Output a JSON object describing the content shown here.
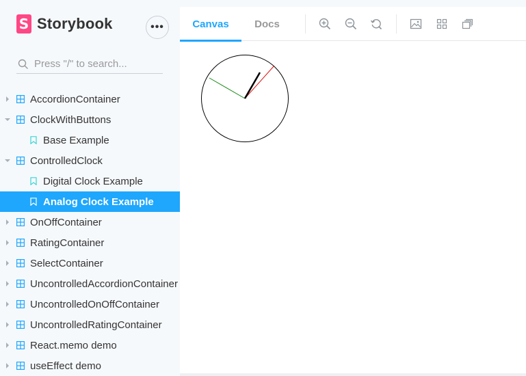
{
  "brand": {
    "logo_letter": "S",
    "name": "Storybook"
  },
  "menu": {
    "label": "•••"
  },
  "search": {
    "placeholder": "Press \"/\" to search..."
  },
  "tree": {
    "items": [
      {
        "label": "AccordionContainer"
      },
      {
        "label": "ClockWithButtons"
      },
      {
        "label": "Base Example"
      },
      {
        "label": "ControlledClock"
      },
      {
        "label": "Digital Clock Example"
      },
      {
        "label": "Analog Clock Example"
      },
      {
        "label": "OnOffContainer"
      },
      {
        "label": "RatingContainer"
      },
      {
        "label": "SelectContainer"
      },
      {
        "label": "UncontrolledAccordionContainer"
      },
      {
        "label": "UncontrolledOnOffContainer"
      },
      {
        "label": "UncontrolledRatingContainer"
      },
      {
        "label": "React.memo demo"
      },
      {
        "label": "useEffect demo"
      }
    ]
  },
  "toolbar": {
    "tabs": [
      {
        "label": "Canvas"
      },
      {
        "label": "Docs"
      }
    ],
    "active_tab": "Canvas",
    "icons": [
      "zoom-in-icon",
      "zoom-out-icon",
      "reset-zoom-icon",
      "background-icon",
      "grid-icon",
      "measure-icon"
    ]
  },
  "colors": {
    "accent": "#1ea7fd",
    "brand": "#ff4785",
    "sidebar_bg": "#f6f9fc",
    "clock_second_hand": "#dd1111",
    "clock_minute_hand": "#118811",
    "clock_hour_hand": "#000000"
  }
}
